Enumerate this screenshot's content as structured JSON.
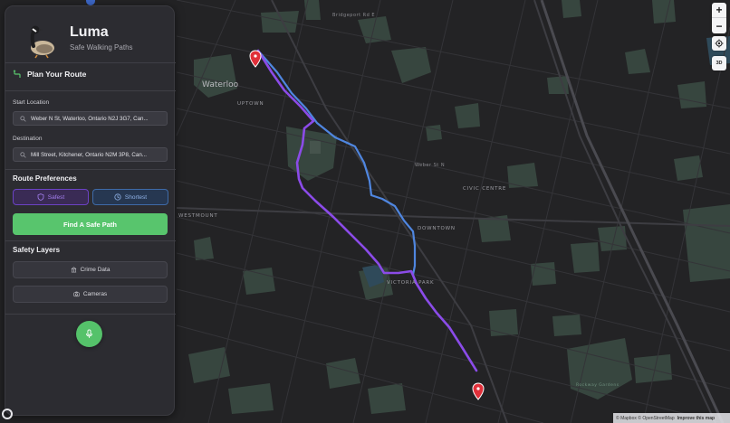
{
  "app": {
    "title": "Luma",
    "subtitle": "Safe Walking Paths"
  },
  "planner": {
    "heading": "Plan Your Route",
    "start_label": "Start Location",
    "start_value": "Weber N St, Waterloo, Ontario N2J 3G7, Can...",
    "destination_label": "Destination",
    "destination_value": "Mill Street, Kitchener, Ontario N2M 3P8, Can...",
    "preferences_heading": "Route Preferences",
    "safest_label": "Safest",
    "shortest_label": "Shortest",
    "cta_label": "Find A Safe Path"
  },
  "layers": {
    "heading": "Safety Layers",
    "crime_label": "Crime Data",
    "cameras_label": "Cameras"
  },
  "map": {
    "zoom_in": "+",
    "zoom_out": "−",
    "view_3d": "3D",
    "labels": {
      "waterloo": "Waterloo",
      "uptown": "UPTOWN",
      "civic": "CIVIC CENTRE",
      "downtown": "DOWNTOWN",
      "westmount": "WESTMOUNT",
      "victoria": "VICTORIA PARK",
      "bridgeport": "Bridgeport Rd E",
      "weber": "Weber St N",
      "park": "Rockway Gardens"
    },
    "attribution": "© Mapbox © OpenStreetMap",
    "improve": "Improve this map"
  },
  "colors": {
    "safest_route": "#8b4be8",
    "shortest_route": "#4f86e0",
    "accent_green": "#58c56d",
    "marker_red": "#e0303a"
  }
}
